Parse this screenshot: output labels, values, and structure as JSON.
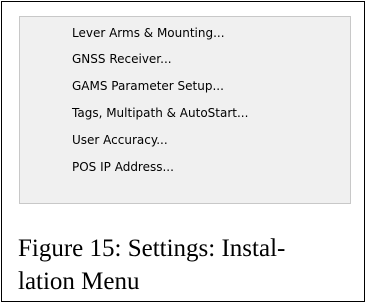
{
  "menu": {
    "items": [
      {
        "label": "Lever Arms & Mounting..."
      },
      {
        "label": "GNSS Receiver..."
      },
      {
        "label": "GAMS Parameter Setup..."
      },
      {
        "label": "Tags, Multipath & AutoStart..."
      },
      {
        "label": "User Accuracy..."
      },
      {
        "label": "POS IP Address..."
      }
    ]
  },
  "caption": {
    "line1": "Figure 15: Settings: Instal-",
    "line2": "lation Menu"
  }
}
